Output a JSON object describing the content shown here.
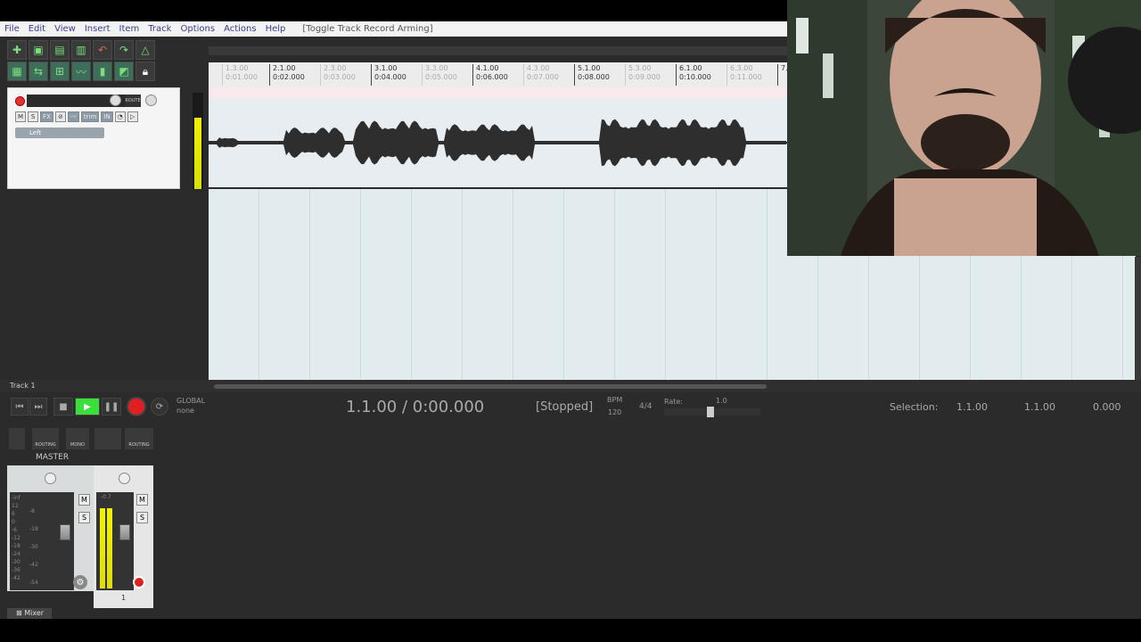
{
  "menu": {
    "items": [
      "File",
      "Edit",
      "View",
      "Insert",
      "Item",
      "Track",
      "Options",
      "Actions",
      "Help"
    ],
    "hint": "[Toggle Track Record Arming]"
  },
  "track": {
    "label_left": "Left",
    "buttons": [
      "M",
      "S",
      "FX",
      "trim",
      "IN"
    ],
    "route_label": "ROUTE",
    "name_bar": "Track 1",
    "number": "1"
  },
  "ruler": {
    "major": [
      "2.1.00",
      "3.1.00",
      "4.1.00",
      "5.1.00",
      "6.1.00",
      "7."
    ],
    "major_time": [
      "0:02.000",
      "0:04.000",
      "0:06.000",
      "0:08.000",
      "0:10.000"
    ],
    "minor": [
      "1.3.00",
      "2.3.00",
      "3.3.00",
      "4.3.00",
      "5.3.00",
      "6.3.00"
    ],
    "minor_time": [
      "0:01.000",
      "0:03.000",
      "0:05.000",
      "0:07.000",
      "0:09.000",
      "0:11.000"
    ]
  },
  "transport": {
    "position": "1.1.00 / 0:00.000",
    "status": "[Stopped]",
    "bpm_label": "BPM",
    "bpm": "120",
    "signature": "4/4",
    "rate_label": "Rate:",
    "rate": "1.0",
    "global_label": "GLOBAL",
    "global_value": "none",
    "selection_label": "Selection:",
    "sel_start": "1.1.00",
    "sel_end": "1.1.00",
    "sel_len": "0.000"
  },
  "mixer": {
    "master_label": "MASTER",
    "routing_label": "ROUTING",
    "mono_label": "MONO",
    "tab_label": "Mixer",
    "master_scale": [
      "-inf",
      "12",
      "6",
      "0",
      "-6",
      "-12",
      "-18",
      "-24",
      "-30",
      "-36",
      "-42"
    ],
    "mid_scale": [
      "-8",
      "-18",
      "-30",
      "-42",
      "-54"
    ],
    "meter_readout": "-0.7"
  },
  "colors": {
    "play": "#3ae03a",
    "record": "#e02020",
    "meter": "#f2f200",
    "waveform": "#2e2e2e"
  }
}
